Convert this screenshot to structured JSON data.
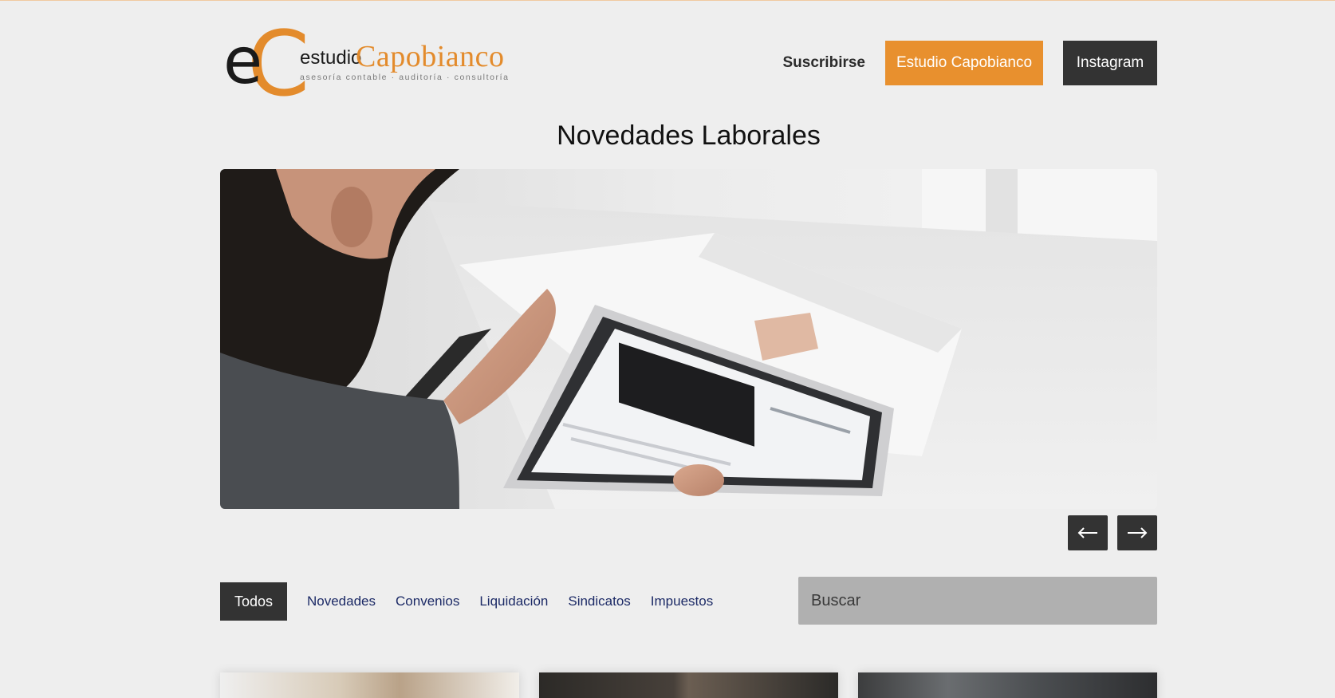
{
  "header": {
    "logo": {
      "letter_e": "e",
      "letter_c": "C",
      "estudio": "estudio",
      "capobianco": "Capobianco",
      "tagline": "asesoría contable · auditoría · consultoría"
    },
    "nav": {
      "subscribe": "Suscribirse",
      "estudio_button": "Estudio Capobianco",
      "instagram_button": "Instagram"
    }
  },
  "page_title": "Novedades Laborales",
  "hero": {
    "image_description_icon": "photo-icon"
  },
  "carousel": {
    "prev_icon": "arrow-left-icon",
    "next_icon": "arrow-right-icon"
  },
  "filters": {
    "items": [
      {
        "label": "Todos",
        "active": true
      },
      {
        "label": "Novedades",
        "active": false
      },
      {
        "label": "Convenios",
        "active": false
      },
      {
        "label": "Liquidación",
        "active": false
      },
      {
        "label": "Sindicatos",
        "active": false
      },
      {
        "label": "Impuestos",
        "active": false
      }
    ]
  },
  "search": {
    "placeholder": "Buscar"
  },
  "colors": {
    "accent_orange": "#e8902e",
    "dark": "#333333",
    "link_blue": "#1c2a66",
    "background": "#eeeeee"
  }
}
